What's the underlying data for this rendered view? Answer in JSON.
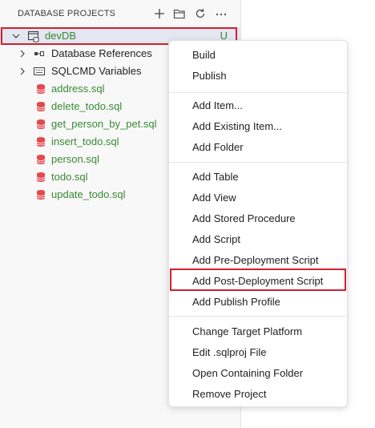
{
  "panel": {
    "title": "DATABASE PROJECTS",
    "actions": [
      {
        "name": "new-project",
        "icon": "plus-icon"
      },
      {
        "name": "open-project",
        "icon": "folder-open-icon"
      },
      {
        "name": "refresh",
        "icon": "refresh-icon"
      },
      {
        "name": "more",
        "icon": "more-icon"
      }
    ]
  },
  "tree": {
    "root": {
      "label": "devDB",
      "status": "U",
      "icon": "database-project-icon"
    },
    "folders": [
      {
        "label": "Database References",
        "icon": "references-icon"
      },
      {
        "label": "SQLCMD Variables",
        "icon": "sqlcmd-variables-icon"
      }
    ],
    "files": [
      {
        "label": "address.sql"
      },
      {
        "label": "delete_todo.sql"
      },
      {
        "label": "get_person_by_pet.sql"
      },
      {
        "label": "insert_todo.sql"
      },
      {
        "label": "person.sql"
      },
      {
        "label": "todo.sql"
      },
      {
        "label": "update_todo.sql"
      }
    ]
  },
  "context_menu": {
    "groups": [
      [
        "Build",
        "Publish"
      ],
      [
        "Add Item...",
        "Add Existing Item...",
        "Add Folder"
      ],
      [
        "Add Table",
        "Add View",
        "Add Stored Procedure",
        "Add Script",
        "Add Pre-Deployment Script",
        "Add Post-Deployment Script",
        "Add Publish Profile"
      ],
      [
        "Change Target Platform",
        "Edit .sqlproj File",
        "Open Containing Folder",
        "Remove Project"
      ]
    ],
    "highlighted": "Add Post-Deployment Script"
  },
  "colors": {
    "accent_highlight": "#d0202e",
    "untracked_green": "#388a34",
    "sql_icon_red": "#e5484d",
    "selection_bg": "#e4e6f1"
  }
}
